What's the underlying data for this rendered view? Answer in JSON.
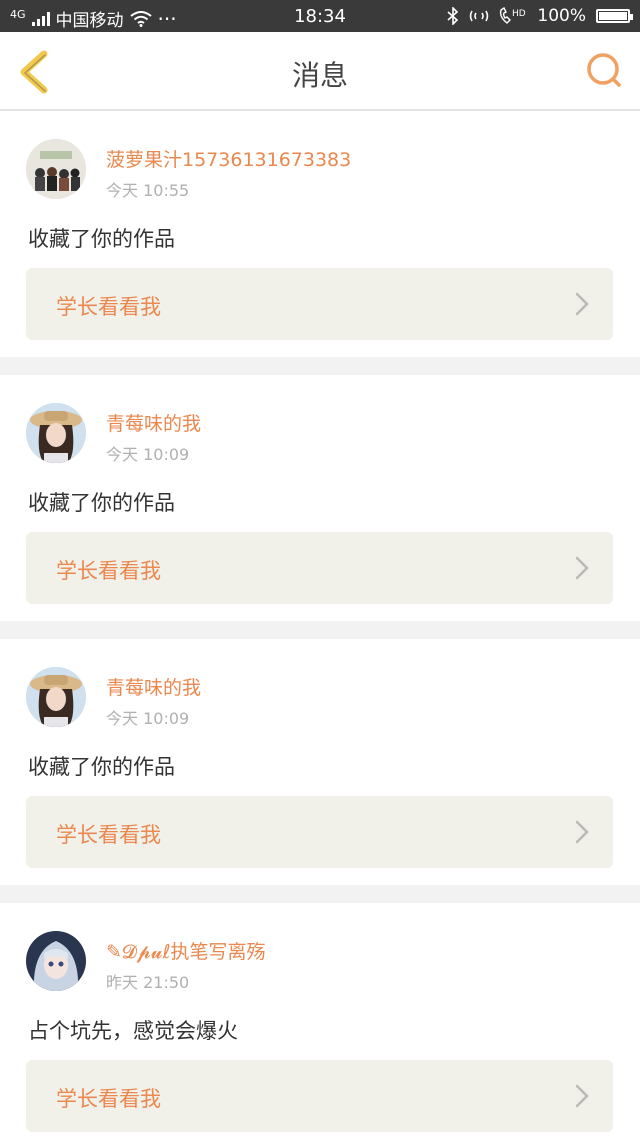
{
  "status_bar": {
    "network": "4G",
    "carrier": "中国移动",
    "dots": "···",
    "time": "18:34",
    "battery_text": "100%",
    "battery_level": 1.0
  },
  "navbar": {
    "title": "消息"
  },
  "colors": {
    "accent": "#e9884f",
    "back_arrow": "#f2c94c",
    "work_bg": "#f2f1e9"
  },
  "messages": [
    {
      "username": "菠萝果汁15736131673383",
      "time": "今天 10:55",
      "text": "收藏了你的作品",
      "work_title": "学长看看我",
      "avatar_icon": "group-photo-avatar"
    },
    {
      "username": "青莓味的我",
      "time": "今天 10:09",
      "text": "收藏了你的作品",
      "work_title": "学长看看我",
      "avatar_icon": "girl-hat-avatar"
    },
    {
      "username": "青莓味的我",
      "time": "今天 10:09",
      "text": "收藏了你的作品",
      "work_title": "学长看看我",
      "avatar_icon": "girl-hat-avatar"
    },
    {
      "username": "✎𝓓𝓹𝓾ℓ执笔写离殇",
      "time": "昨天 21:50",
      "text": "占个坑先，感觉会爆火",
      "work_title": "学长看看我",
      "avatar_icon": "anime-girl-avatar"
    }
  ]
}
